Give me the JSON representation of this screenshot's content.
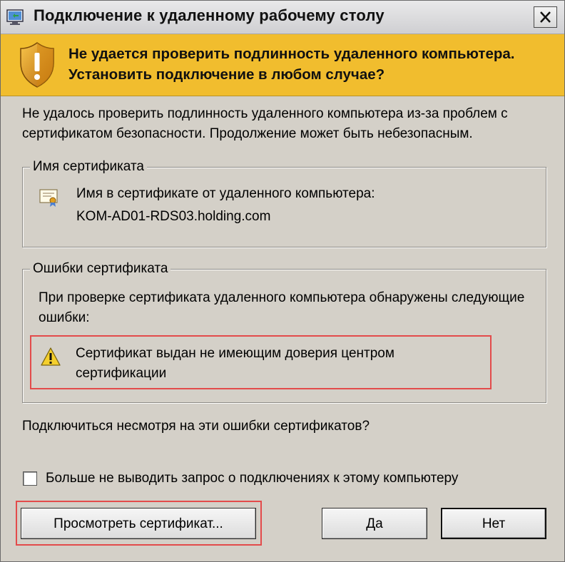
{
  "window": {
    "title": "Подключение к удаленному рабочему столу"
  },
  "banner": {
    "heading": "Не удается проверить подлинность удаленного компьютера. Установить подключение в любом случае?"
  },
  "intro_text": "Не удалось проверить подлинность удаленного компьютера из-за проблем с сертификатом безопасности. Продолжение может быть небезопасным.",
  "certificate_name": {
    "legend": "Имя сертификата",
    "label": "Имя в сертификате от удаленного компьютера:",
    "value": "KOM-AD01-RDS03.holding.com"
  },
  "certificate_errors": {
    "legend": "Ошибки сертификата",
    "intro": "При проверке сертификата удаленного компьютера обнаружены следующие ошибки:",
    "items": [
      {
        "text": "Сертификат выдан не имеющим доверия центром сертификации",
        "icon": "warning-icon"
      }
    ]
  },
  "question": "Подключиться несмотря на эти ошибки сертификатов?",
  "dont_ask": {
    "label": "Больше не выводить запрос о подключениях к этому компьютеру",
    "checked": false
  },
  "buttons": {
    "view_certificate": "Просмотреть сертификат...",
    "yes": "Да",
    "no": "Нет"
  },
  "colors": {
    "banner": "#f1bd2e",
    "highlight": "#e34b4b",
    "dialog_bg": "#d4d0c8"
  }
}
